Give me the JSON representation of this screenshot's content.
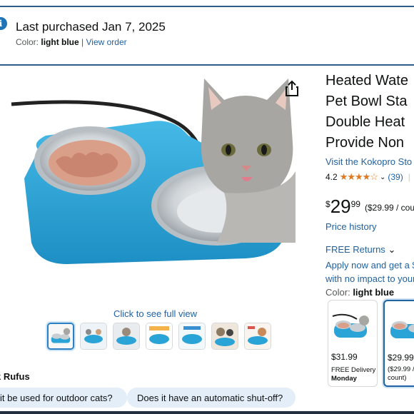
{
  "notice": {
    "info_icon": "i",
    "title": "Last purchased Jan 7, 2025",
    "color_label": "Color:",
    "color_value": "light blue",
    "separator": "|",
    "view_order": "View order"
  },
  "gallery": {
    "click_full_view": "Click to see full view",
    "thumbnail_count": 7,
    "selected_index": 0
  },
  "product": {
    "title_lines": [
      "Heated Wate",
      "Pet Bowl Sta",
      "Double Heat",
      "Provide Non"
    ],
    "store_link": "Visit the Kokopro Sto",
    "rating": "4.2",
    "stars_filled": 4,
    "review_count": "(39)",
    "price_symbol": "$",
    "price_whole": "29",
    "price_fraction": "99",
    "price_per_unit": "($29.99 / cou",
    "price_history": "Price history",
    "free_returns": "FREE Returns",
    "apply_line1": "Apply now and get a $",
    "apply_line2": "with no impact to your",
    "color_label": "Color:",
    "color_value": "light blue"
  },
  "variants": [
    {
      "price": "$31.99",
      "line1": "FREE Delivery",
      "line2": "Monday"
    },
    {
      "price": "$29.99",
      "line1": "($29.99 /",
      "line2": "count)"
    }
  ],
  "rufus": {
    "label": "k Rufus",
    "chips": [
      "it be used for outdoor cats?",
      "Does it have an automatic shut-off?"
    ]
  },
  "colors": {
    "link": "#2162a1",
    "bowl_blue": "#2aa3d6",
    "star": "#de7921",
    "frame": "#2d5f8a"
  }
}
